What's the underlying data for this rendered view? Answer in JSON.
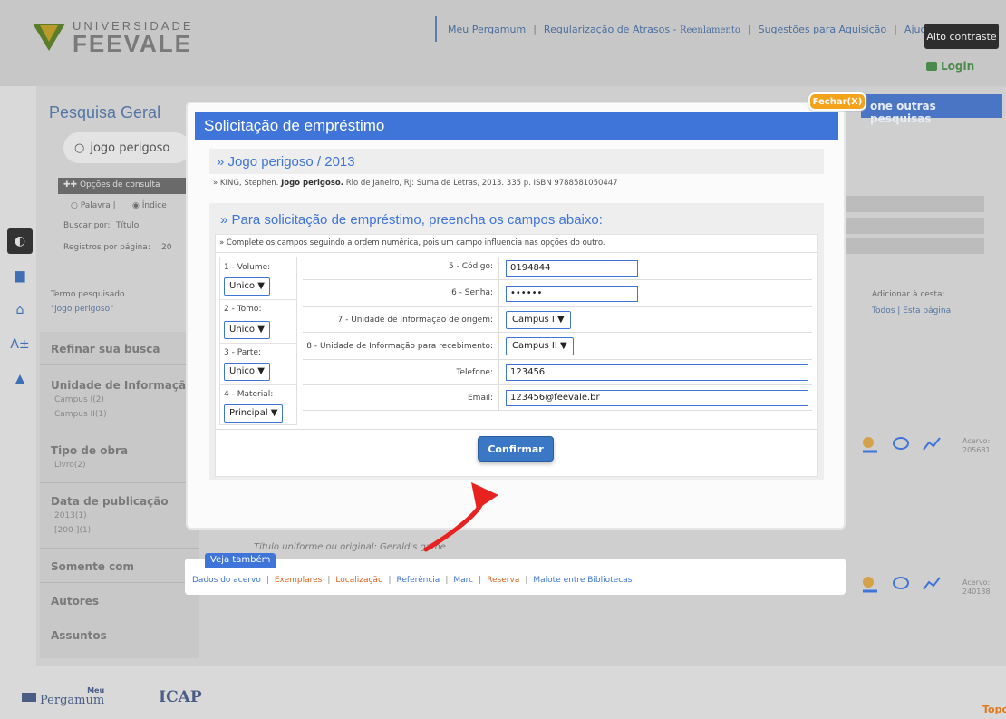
{
  "header": {
    "logo_top": "UNIVERSIDADE",
    "logo_bottom": "FEEVALE",
    "menu": [
      {
        "label": "Meu Pergamum"
      },
      {
        "label": "Regularização de Atrasos - "
      },
      {
        "label": "Sugestões para Aquisição"
      },
      {
        "label": "Ajuda"
      }
    ],
    "menu_link": "Reenlamento",
    "contrast_label": "Alto contraste",
    "login_label": "Login"
  },
  "background": {
    "search_title": "Pesquisa Geral",
    "search_value": "jogo perigoso",
    "options_label": "Opções de consulta",
    "radio_palavra": "Palavra |",
    "radio_indice": "Índice",
    "buscar_por_label": "Buscar por:",
    "buscar_por_value": "Título",
    "registros_label": "Registros por página:",
    "registros_value": "20",
    "outras_pesquisas": "one outras pesquisas",
    "termo_label": "Termo pesquisado",
    "termo_value": "\"jogo perigoso\"",
    "cesta_label": "Adicionar à cesta:",
    "cesta_links": "Todos  |  Esta página",
    "refinar": "Refinar sua busca",
    "facets": [
      {
        "title": "Unidade de Informação",
        "items": [
          "Campus I(2)",
          "Campus II(1)"
        ]
      },
      {
        "title": "Tipo de obra",
        "items": [
          "Livro(2)"
        ]
      },
      {
        "title": "Data de publicação",
        "items": [
          "2013(1)",
          "[200-](1)"
        ]
      },
      {
        "title": "Somente com",
        "items": []
      },
      {
        "title": "Autores",
        "items": []
      },
      {
        "title": "Assuntos",
        "items": []
      }
    ],
    "titulo_uniforme": "Título uniforme ou original: Gerald's game",
    "acervo_1": "Acervo:",
    "acervo_1_num": "205681",
    "acervo_2": "Acervo:",
    "acervo_2_num": "240138",
    "footer_pergamum_top": "Meu",
    "footer_pergamum": "Pergamum",
    "footer_icap": "ICAP",
    "topo": "Topo"
  },
  "modal": {
    "close_label": "Fechar(X)",
    "title": "Solicitação de empréstimo",
    "book_title": "» Jogo perigoso / 2013",
    "book_ref_pre": "» KING, Stephen. ",
    "book_ref_bold": "Jogo perigoso.",
    "book_ref_post": " Rio de Janeiro, RJ: Suma de Letras, 2013. 335 p. ISBN 9788581050447",
    "form_title": "» Para solicitação de empréstimo, preencha os campos abaixo:",
    "form_note": "» Complete os campos seguindo a ordem numérica, pois um campo influencia nas opções do outro.",
    "left_fields": [
      {
        "label": "1 - Volume:",
        "value": "Unico ▼"
      },
      {
        "label": "2 - Tomo:",
        "value": "Unico ▼"
      },
      {
        "label": "3 - Parte:",
        "value": "Unico ▼"
      },
      {
        "label": "4 - Material:",
        "value": "Principal ▼"
      }
    ],
    "codigo_label": "5 - Código:",
    "codigo_value": "0194844",
    "senha_label": "6 - Senha:",
    "senha_value": "••••••",
    "origem_label": "7 - Unidade de Informação de origem:",
    "origem_value": "Campus I  ▼",
    "recebimento_label": "8 - Unidade de Informação para recebimento:",
    "recebimento_value": "Campus II   ▼",
    "telefone_label": "Telefone:",
    "telefone_value": "123456",
    "email_label": "Email:",
    "email_value": "123456@feevale.br",
    "confirm_label": "Confirmar"
  },
  "veja": {
    "tab": "Veja também",
    "links": [
      {
        "label": "Dados do acervo",
        "color": "blue"
      },
      {
        "label": "Exemplares",
        "color": "orange"
      },
      {
        "label": "Localização",
        "color": "orange"
      },
      {
        "label": "Referência",
        "color": "blue"
      },
      {
        "label": "Marc",
        "color": "blue"
      },
      {
        "label": "Reserva",
        "color": "orange"
      },
      {
        "label": "Malote entre Bibliotecas",
        "color": "blue"
      }
    ]
  },
  "colors": {
    "accent": "#3f74d8",
    "close": "#f3a21c",
    "arrow": "#e8221f"
  }
}
